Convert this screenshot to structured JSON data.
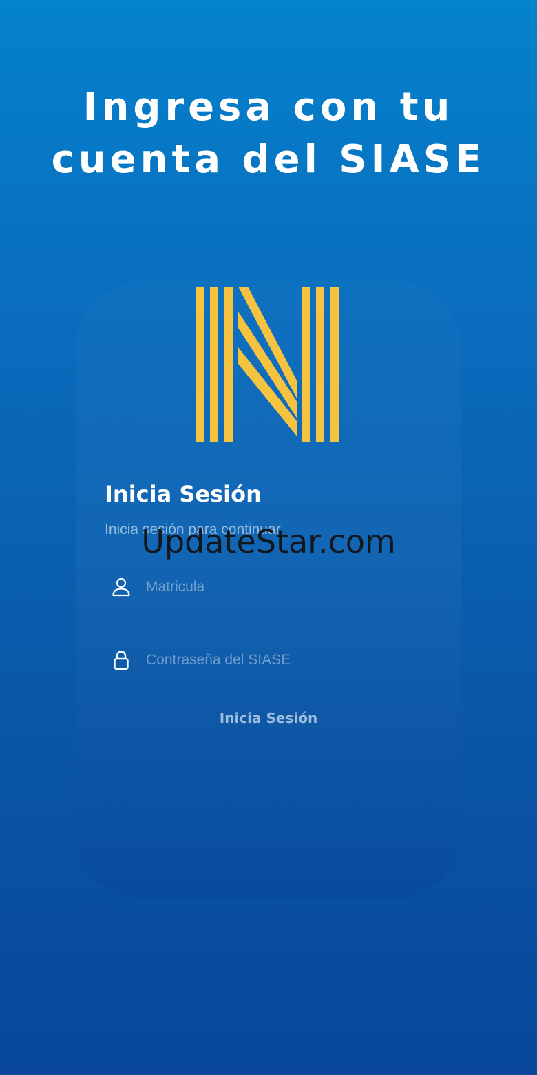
{
  "headline": {
    "line1": "Ingresa con tu",
    "line2": "cuenta del SIASE"
  },
  "logo": {
    "icon": "uanl-n-logo",
    "color": "#f6c340"
  },
  "login_card": {
    "title": "Inicia Sesión",
    "subtitle": "Inicia sesión para continuar",
    "fields": {
      "username": {
        "icon": "user-icon",
        "placeholder": "Matricula",
        "value": ""
      },
      "password": {
        "icon": "lock-icon",
        "placeholder": "Contraseña del SIASE",
        "value": ""
      }
    },
    "submit_label": "Inicia Sesión"
  },
  "watermark": {
    "text": "UpdateStar.com"
  },
  "colors": {
    "background_top": "#0482cc",
    "background_bottom": "#08479a",
    "accent": "#f6c340",
    "text": "#ffffff"
  }
}
